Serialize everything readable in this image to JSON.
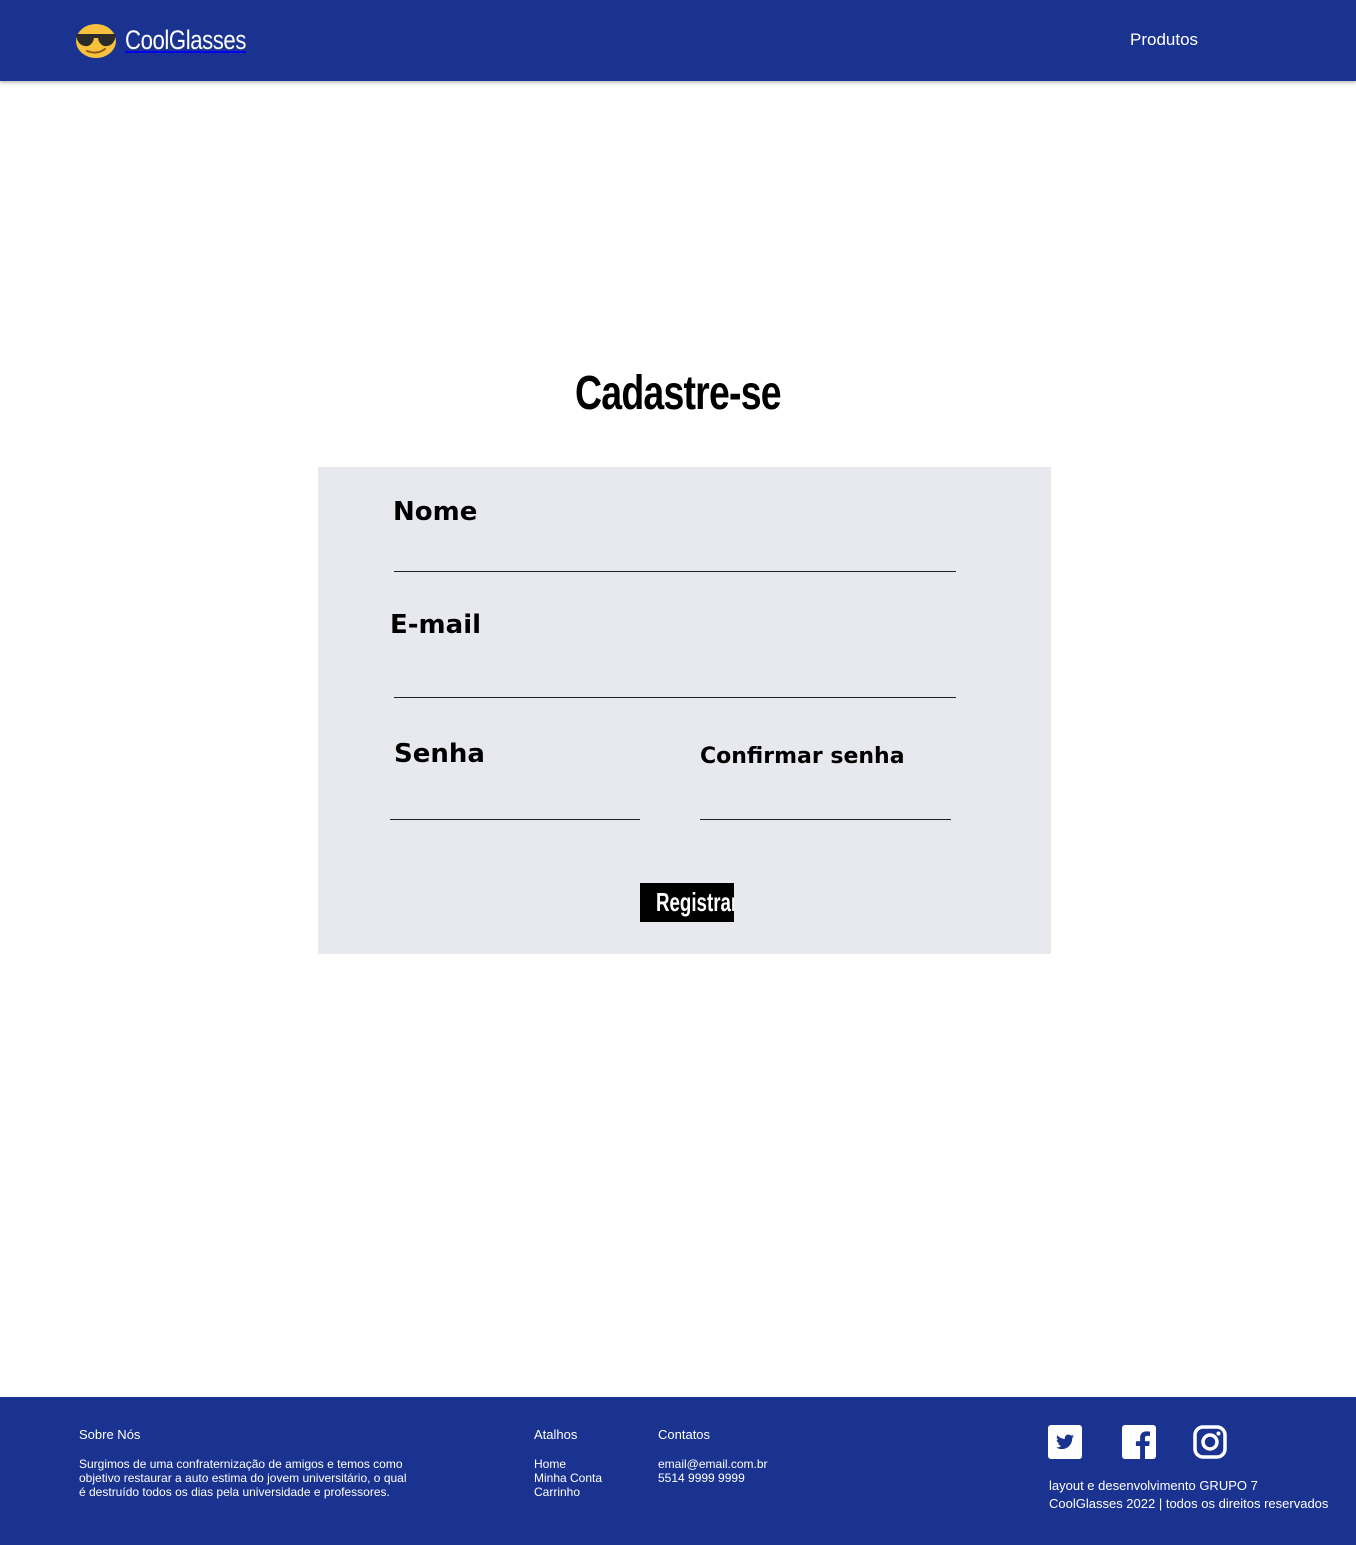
{
  "header": {
    "logo_text": "CoolGlasses",
    "nav": {
      "produtos": "Produtos"
    },
    "brand_color": "#1a3391"
  },
  "main": {
    "title": "Cadastre-se",
    "form": {
      "name_label": "Nome",
      "email_label": "E-mail",
      "password_label": "Senha",
      "confirm_password_label": "Confirmar senha",
      "name_value": "",
      "email_value": "",
      "password_value": "",
      "confirm_password_value": "",
      "submit_label": "Registrar",
      "background_color": "#e8e8ef"
    }
  },
  "footer": {
    "about": {
      "heading": "Sobre Nós",
      "line1": "Surgimos de uma confraternização de amigos e temos como",
      "line2": "objetivo restaurar a auto estima do jovem universitário, o qual",
      "line3": "é destruído todos os dias pela universidade e professores."
    },
    "shortcuts": {
      "heading": "Atalhos",
      "home": "Home",
      "account": "Minha Conta",
      "cart": "Carrinho"
    },
    "contacts": {
      "heading": "Contatos",
      "email": "email@email.com.br",
      "phone": "5514 9999 9999"
    },
    "social_icons": [
      "twitter-icon",
      "facebook-icon",
      "instagram-icon"
    ],
    "credits": {
      "line1": "layout e desenvolvimento GRUPO 7",
      "line2": "CoolGlasses 2022 | todos os direitos reservados"
    }
  }
}
